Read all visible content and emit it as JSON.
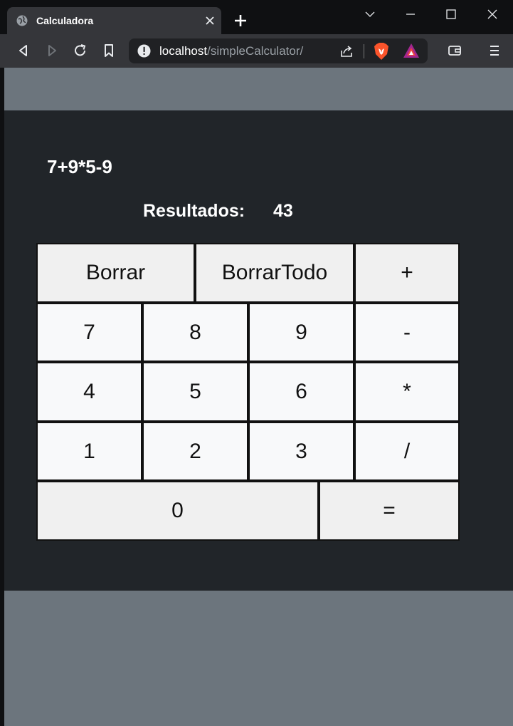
{
  "browser": {
    "tab_title": "Calculadora",
    "url_host": "localhost",
    "url_path": "/simpleCalculator/"
  },
  "calculator": {
    "expression": "7+9*5-9",
    "result_label": "Resultados:",
    "result_value": "43",
    "keys": {
      "borrar": "Borrar",
      "borrar_todo": "BorrarTodo",
      "plus": "+",
      "seven": "7",
      "eight": "8",
      "nine": "9",
      "minus": "-",
      "four": "4",
      "five": "5",
      "six": "6",
      "multiply": "*",
      "one": "1",
      "two": "2",
      "three": "3",
      "divide": "/",
      "zero": "0",
      "equals": "="
    }
  }
}
